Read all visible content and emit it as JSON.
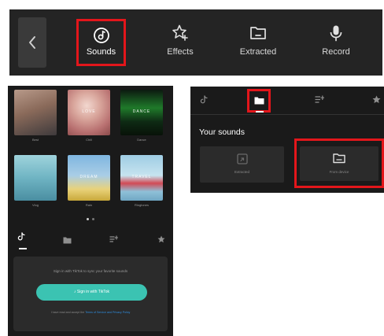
{
  "toolbar": {
    "items": [
      {
        "label": "Sounds"
      },
      {
        "label": "Effects"
      },
      {
        "label": "Extracted"
      },
      {
        "label": "Record"
      }
    ]
  },
  "library": {
    "covers": [
      {
        "title": "",
        "caption": "Best"
      },
      {
        "title": "LOVE",
        "caption": "Chill"
      },
      {
        "title": "DANCE",
        "caption": "Dance"
      },
      {
        "title": "",
        "caption": "Vlog"
      },
      {
        "title": "DREAM",
        "caption": "Rain"
      },
      {
        "title": "TRAVEL",
        "caption": "Ringtones"
      }
    ]
  },
  "signin": {
    "prompt": "Sign in with TikTok to sync your favorite sounds",
    "button": "Sign in with TikTok",
    "terms": "I have read and accept the",
    "terms_link": "Terms of Service and Privacy Policy"
  },
  "sounds_panel": {
    "title": "Your sounds",
    "extracted_label": "Extracted",
    "from_device_label": "From device"
  },
  "colors": {
    "highlight": "#e3161b",
    "accent": "#3bc3b2",
    "panel_bg": "#1a1a1a"
  }
}
